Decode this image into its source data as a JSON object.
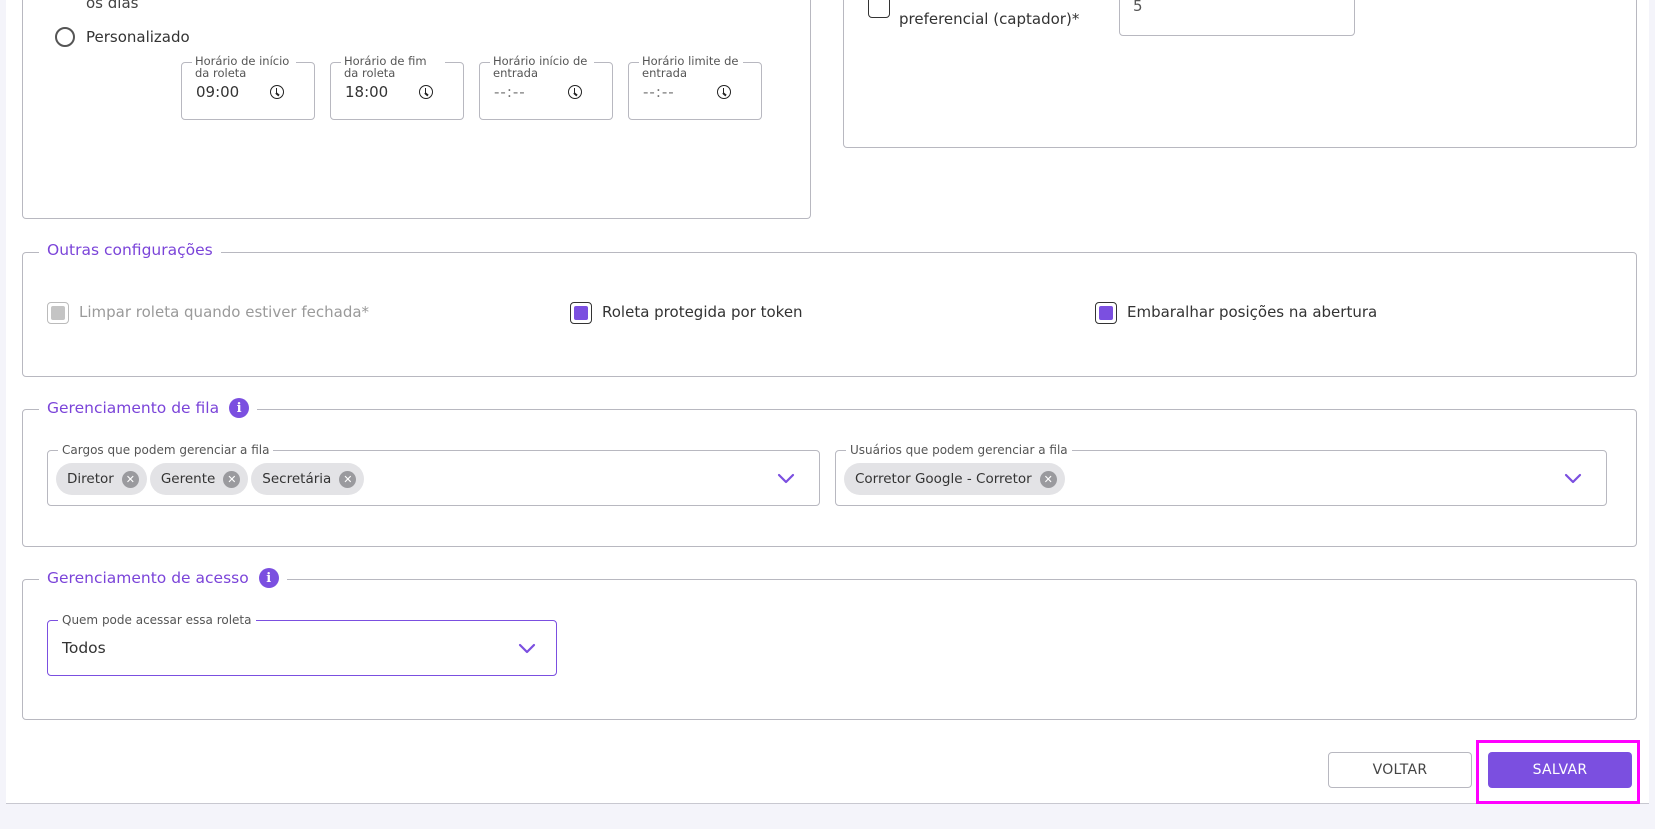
{
  "schedule": {
    "partial_text": "os dias",
    "custom_label": "Personalizado",
    "fields": [
      {
        "label": "Horário de início da roleta",
        "value": "09:00",
        "placeholder": false
      },
      {
        "label": "Horário de fim da roleta",
        "value": "18:00",
        "placeholder": false
      },
      {
        "label": "Horário início de entrada",
        "value": "--:--",
        "placeholder": true
      },
      {
        "label": "Horário limite de entrada",
        "value": "--:--",
        "placeholder": true
      }
    ]
  },
  "preferential": {
    "label": "preferencial (captador)*",
    "value": "5"
  },
  "other_settings": {
    "legend": "Outras configurações",
    "options": [
      {
        "label": "Limpar roleta quando estiver fechada*",
        "checked": true,
        "disabled": true
      },
      {
        "label": "Roleta protegida por token",
        "checked": true,
        "disabled": false
      },
      {
        "label": "Embaralhar posições na abertura",
        "checked": true,
        "disabled": false
      }
    ]
  },
  "queue_management": {
    "legend": "Gerenciamento de fila",
    "roles_label": "Cargos que podem gerenciar a fila",
    "roles": [
      "Diretor",
      "Gerente",
      "Secretária"
    ],
    "users_label": "Usuários que podem gerenciar a fila",
    "users": [
      "Corretor Google - Corretor"
    ]
  },
  "access_management": {
    "legend": "Gerenciamento de acesso",
    "access_label": "Quem pode acessar essa roleta",
    "access_value": "Todos"
  },
  "actions": {
    "back_label": "VOLTAR",
    "save_label": "SALVAR"
  },
  "colors": {
    "accent": "#7b4fe0",
    "highlight": "#ff00ff"
  }
}
